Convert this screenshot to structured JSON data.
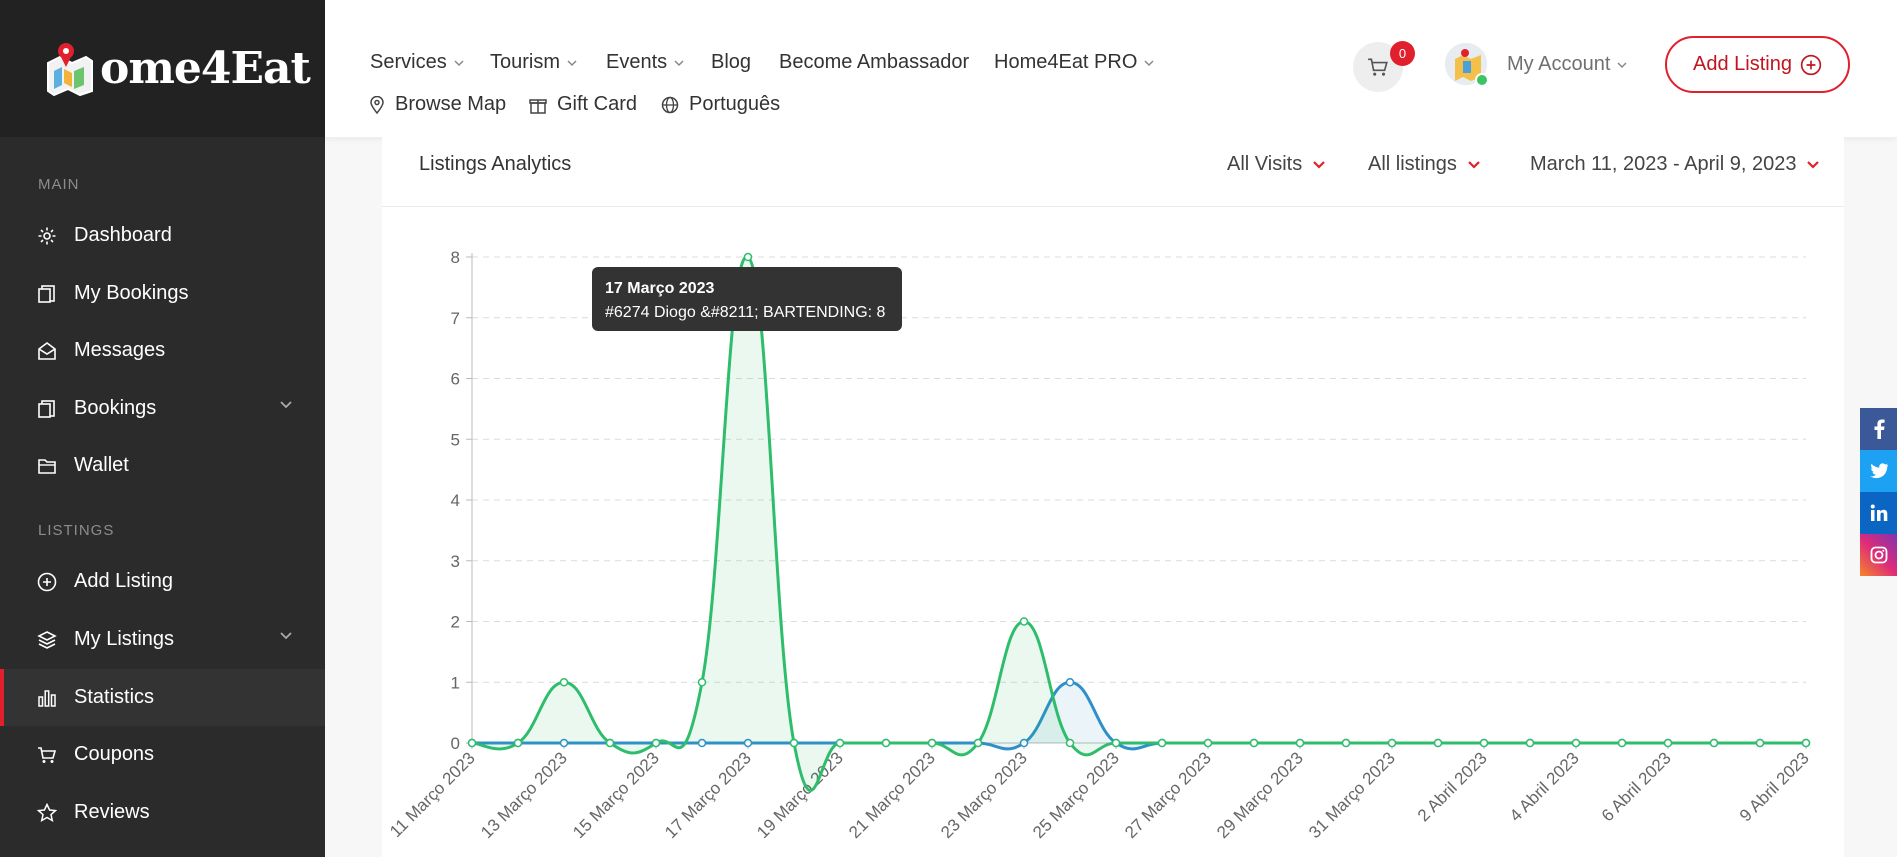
{
  "brand": {
    "logo_text": "ome4Eat"
  },
  "sidebar": {
    "sections": [
      {
        "label": "MAIN"
      },
      {
        "label": "LISTINGS"
      }
    ],
    "items": [
      {
        "label": "Dashboard",
        "icon": "gear-icon"
      },
      {
        "label": "My Bookings",
        "icon": "bookings-icon"
      },
      {
        "label": "Messages",
        "icon": "envelope-icon"
      },
      {
        "label": "Bookings",
        "icon": "bookings-icon",
        "has_submenu": true
      },
      {
        "label": "Wallet",
        "icon": "wallet-icon"
      },
      {
        "label": "Add Listing",
        "icon": "plus-circle-icon"
      },
      {
        "label": "My Listings",
        "icon": "layers-icon",
        "has_submenu": true
      },
      {
        "label": "Statistics",
        "icon": "bar-chart-icon",
        "active": true
      },
      {
        "label": "Coupons",
        "icon": "cart-icon"
      },
      {
        "label": "Reviews",
        "icon": "star-icon"
      }
    ]
  },
  "topnav": {
    "row1": [
      "Services",
      "Tourism",
      "Events",
      "Blog",
      "Become Ambassador",
      "Home4Eat PRO"
    ],
    "row2": [
      "Browse Map",
      "Gift Card",
      "Português"
    ],
    "cart_count": "0",
    "account_label": "My Account",
    "add_listing_label": "Add Listing"
  },
  "panel": {
    "title": "Listings Analytics",
    "filters": {
      "visits": "All Visits",
      "listings": "All listings",
      "date_range": "March 11, 2023 - April 9, 2023"
    }
  },
  "tooltip": {
    "title": "17 Março 2023",
    "body": "#6274 Diogo &#8211; BARTENDING: 8"
  },
  "colors": {
    "accent": "#e0202c",
    "green_series": "#2ebd6b",
    "blue_series": "#2f8fc9",
    "sidebar_bg": "#2b2b2b"
  },
  "social": [
    "facebook-icon",
    "twitter-icon",
    "linkedin-icon",
    "instagram-icon"
  ],
  "chart_data": {
    "type": "line",
    "ylim": [
      0,
      8
    ],
    "yticks": [
      0,
      1,
      2,
      3,
      4,
      5,
      6,
      7,
      8
    ],
    "x": [
      "11 Março 2023",
      "12 Março 2023",
      "13 Março 2023",
      "14 Março 2023",
      "15 Março 2023",
      "16 Março 2023",
      "17 Março 2023",
      "18 Março 2023",
      "19 Março 2023",
      "20 Março 2023",
      "21 Março 2023",
      "22 Março 2023",
      "23 Março 2023",
      "24 Março 2023",
      "25 Março 2023",
      "26 Março 2023",
      "27 Março 2023",
      "28 Março 2023",
      "29 Março 2023",
      "30 Março 2023",
      "31 Março 2023",
      "1 Abril 2023",
      "2 Abril 2023",
      "3 Abril 2023",
      "4 Abril 2023",
      "5 Abril 2023",
      "6 Abril 2023",
      "7 Abril 2023",
      "8 Abril 2023",
      "9 Abril 2023"
    ],
    "x_tick_labels": [
      "11 Março 2023",
      "13 Março 2023",
      "15 Março 2023",
      "17 Março 2023",
      "19 Março 2023",
      "21 Março 2023",
      "23 Março 2023",
      "25 Março 2023",
      "27 Março 2023",
      "29 Março 2023",
      "31 Março 2023",
      "2 Abril 2023",
      "4 Abril 2023",
      "6 Abril 2023",
      "9 Abril 2023"
    ],
    "series": [
      {
        "color": "#2ebd6b",
        "fill": "rgba(46,189,107,0.10)",
        "values": [
          0,
          0,
          1,
          0,
          0,
          1,
          8,
          0,
          0,
          0,
          0,
          0,
          2,
          0,
          0,
          0,
          0,
          0,
          0,
          0,
          0,
          0,
          0,
          0,
          0,
          0,
          0,
          0,
          0,
          0
        ]
      },
      {
        "color": "#2f8fc9",
        "fill": "rgba(47,143,201,0.10)",
        "values": [
          0,
          0,
          0,
          0,
          0,
          0,
          0,
          0,
          0,
          0,
          0,
          0,
          0,
          1,
          0,
          0,
          0,
          0,
          0,
          0,
          0,
          0,
          0,
          0,
          0,
          0,
          0,
          0,
          0,
          0
        ]
      }
    ],
    "grid": true
  }
}
